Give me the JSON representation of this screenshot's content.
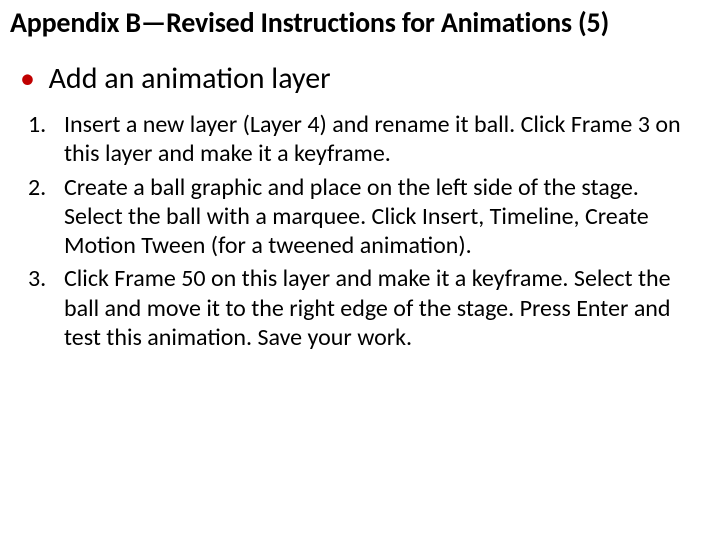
{
  "title": "Appendix B—Revised Instructions for Animations (5)",
  "section": "Add an animation layer",
  "steps": {
    "s1": "Insert a new layer (Layer 4) and rename it ball. Click Frame 3 on this layer and make it a keyframe.",
    "s2": "Create a ball graphic and place on the left side of the stage. Select the ball with a marquee. Click Insert, Timeline, Create Motion Tween (for a tweened animation).",
    "s3": "Click Frame 50 on this layer and make it a keyframe. Select the ball and move it to the right edge of the stage. Press Enter and test this animation. Save your work."
  }
}
